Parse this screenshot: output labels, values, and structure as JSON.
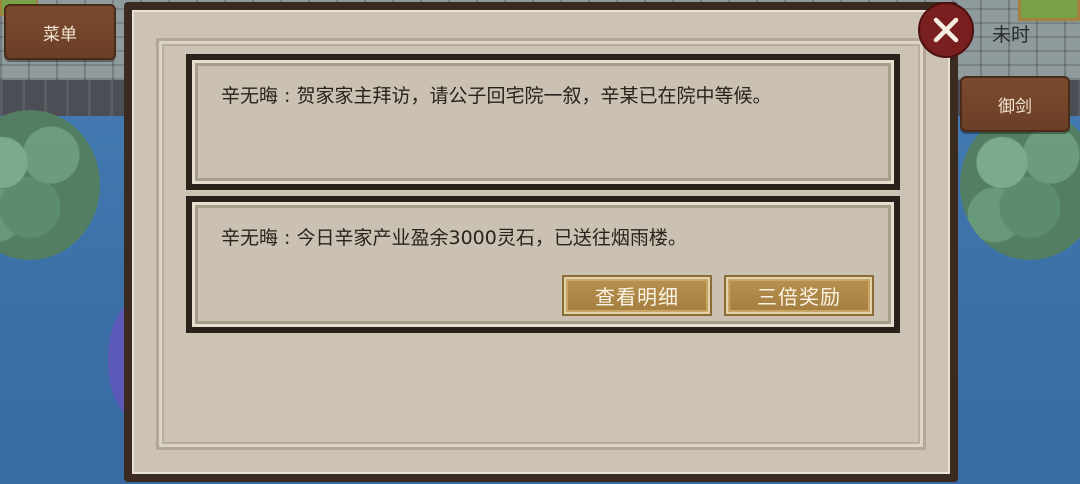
{
  "hud": {
    "menu_label": "菜单",
    "time_label": "未时",
    "sword_label": "御剑"
  },
  "messages": [
    {
      "speaker": "辛无晦",
      "text": "辛无晦 : 贺家家主拜访，请公子回宅院一叙，辛某已在院中等候。"
    },
    {
      "speaker": "辛无晦",
      "text": "辛无晦 : 今日辛家产业盈余3000灵石，已送往烟雨楼。"
    }
  ],
  "actions": {
    "detail_label": "查看明细",
    "triple_reward_label": "三倍奖励"
  },
  "icons": {
    "close": "close-icon"
  },
  "colors": {
    "panel_bg": "#cdc3b4",
    "hud_button": "#6b3f27",
    "gold_button": "#a47f40",
    "close_button": "#7a1f1f"
  }
}
